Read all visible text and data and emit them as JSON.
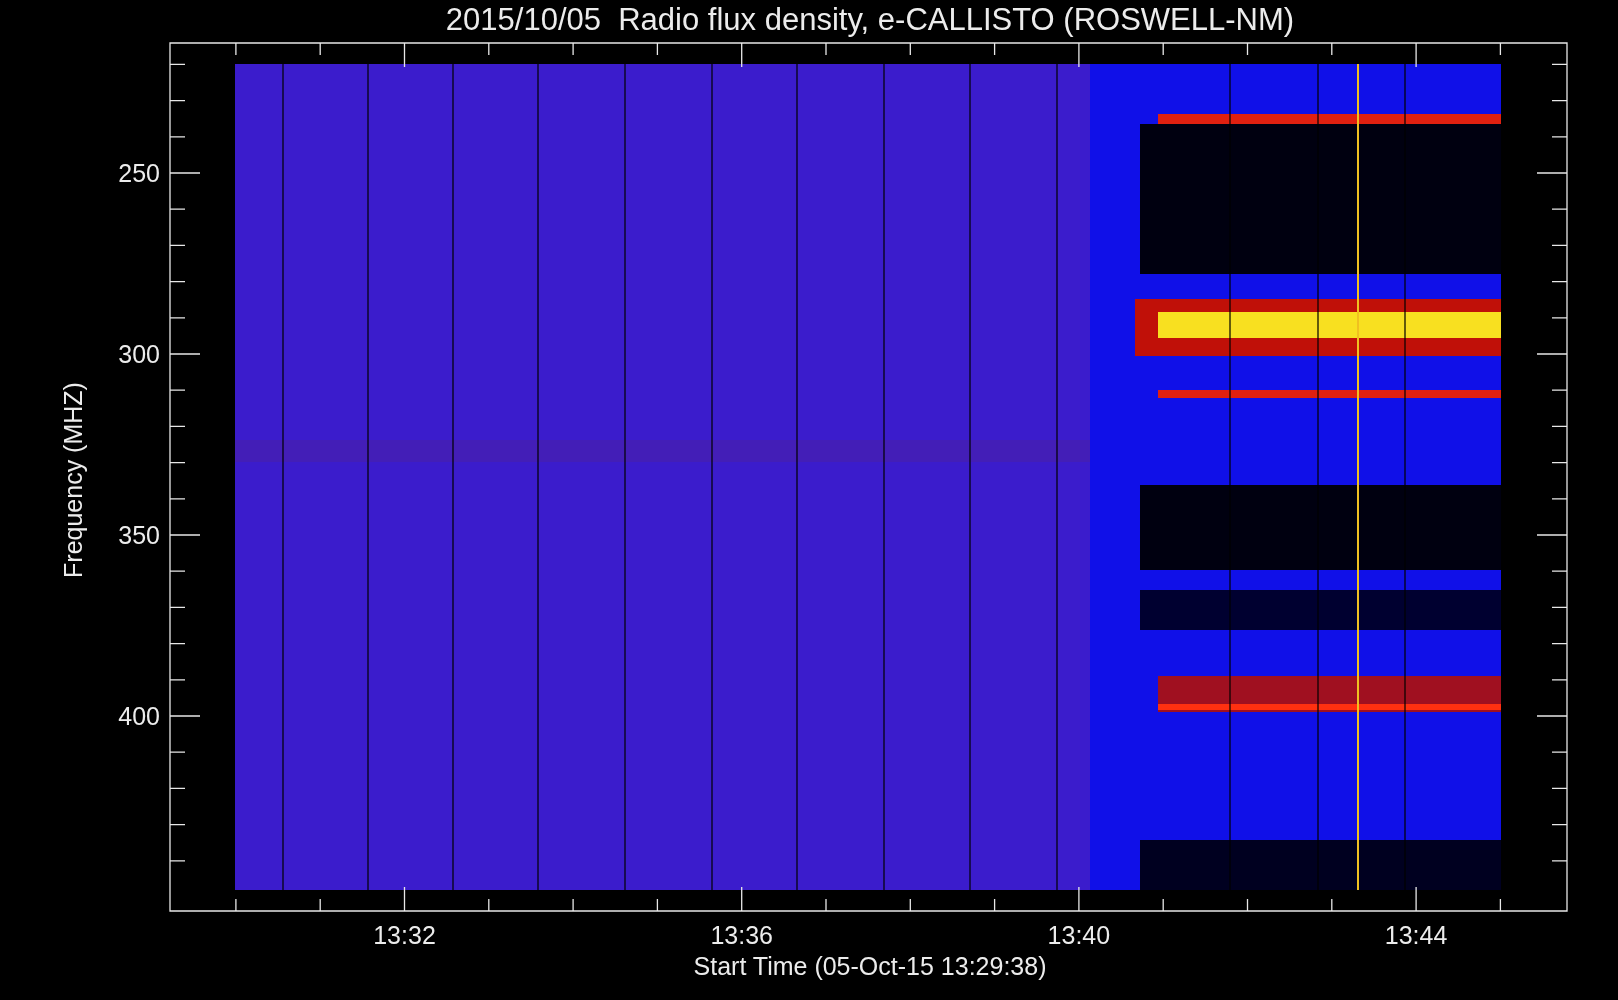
{
  "plot": {
    "title": "2015/10/05  Radio flux density, e-CALLISTO (ROSWELL-NM)",
    "ylabel": "Frequency (MHZ)",
    "xlabel": "Start Time (05-Oct-15 13:29:38)",
    "yticks": [
      "250",
      "300",
      "350",
      "400"
    ],
    "xticks": [
      "13:32",
      "13:36",
      "13:40",
      "13:44"
    ]
  }
}
